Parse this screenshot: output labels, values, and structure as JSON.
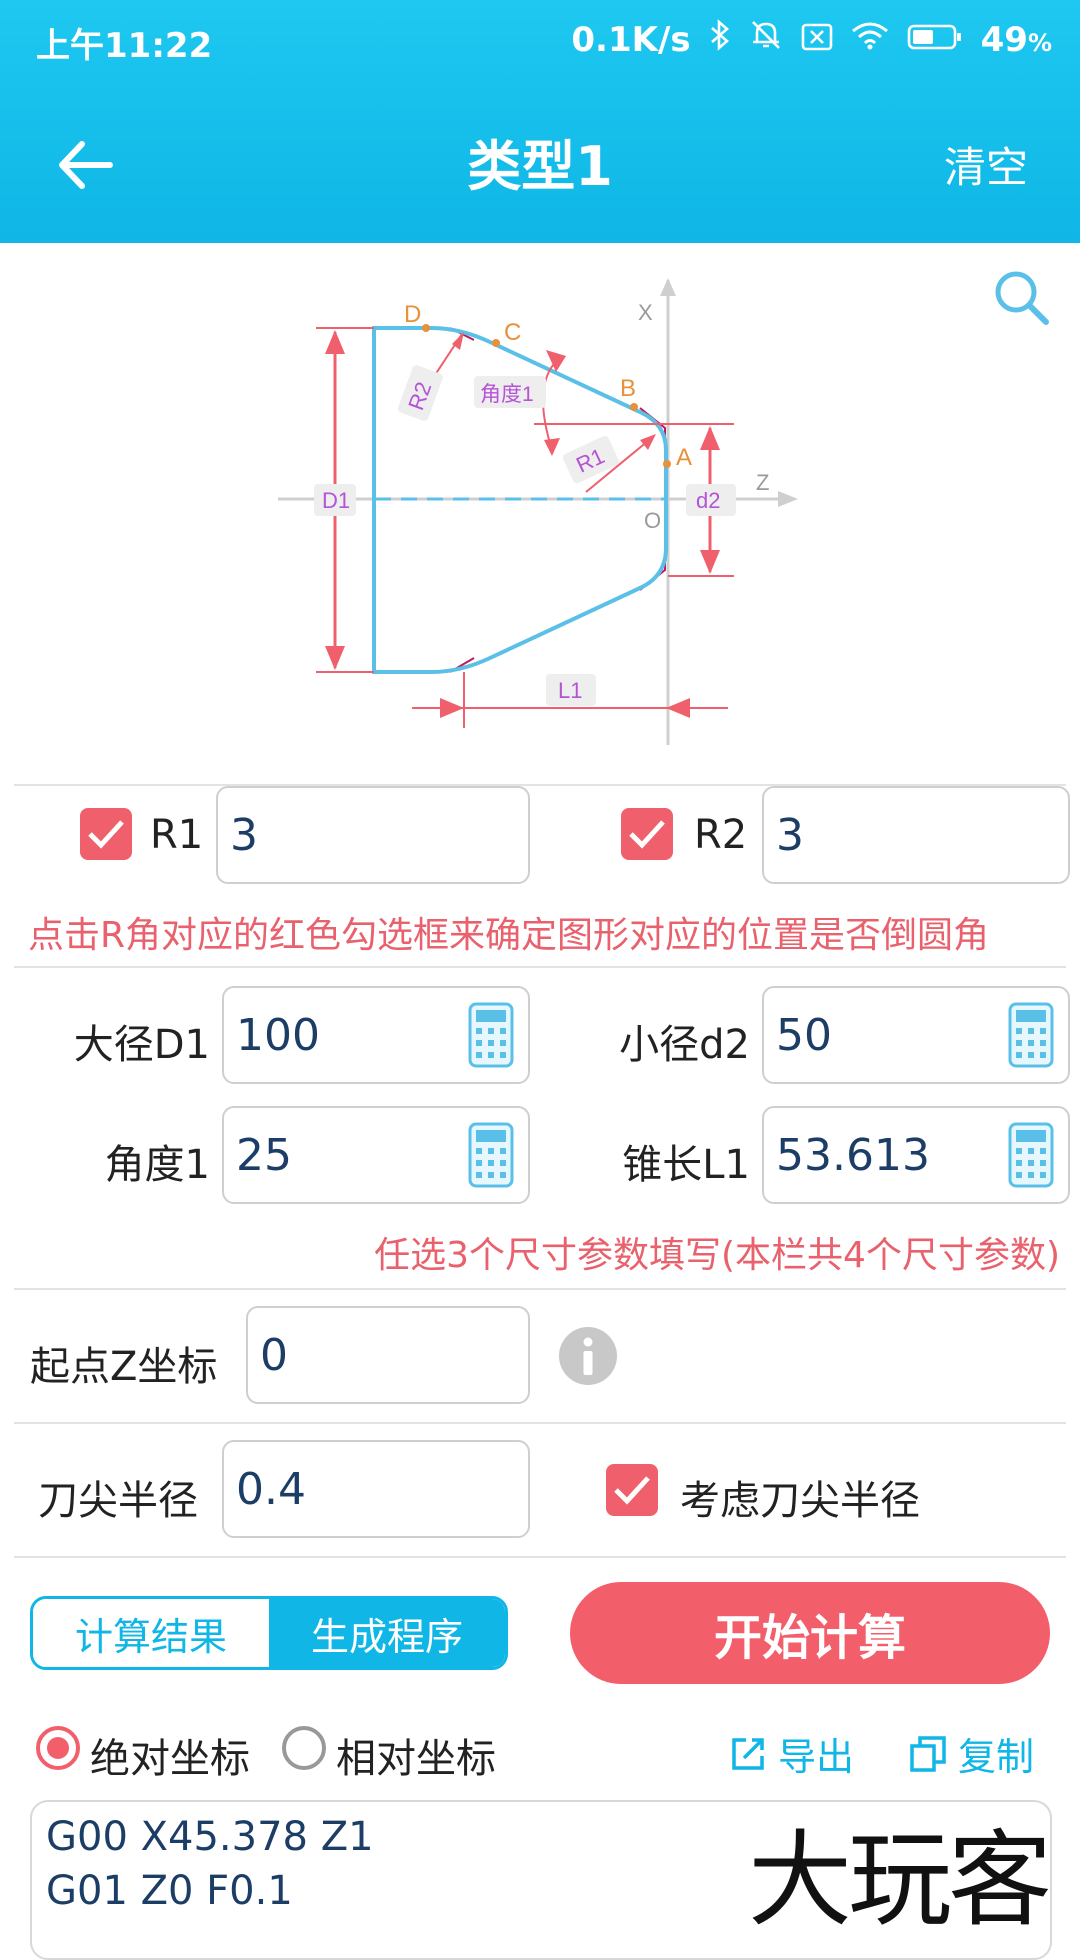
{
  "status_bar": {
    "time": "上午11:22",
    "net_speed": "0.1K/s",
    "battery": "49"
  },
  "header": {
    "title": "类型1",
    "clear_label": "清空"
  },
  "diagram": {
    "labels": {
      "x_axis": "X",
      "z_axis": "Z",
      "origin": "O",
      "point_a": "A",
      "point_b": "B",
      "point_c": "C",
      "point_d": "D",
      "r1": "R1",
      "r2": "R2",
      "angle1": "角度1",
      "d1": "D1",
      "d2": "d2",
      "l1": "L1"
    }
  },
  "fillet": {
    "r1_label": "R1",
    "r1_value": "3",
    "r1_checked": true,
    "r2_label": "R2",
    "r2_value": "3",
    "r2_checked": true,
    "note": "点击R角对应的红色勾选框来确定图形对应的位置是否倒圆角"
  },
  "dimensions": {
    "d1_label": "大径D1",
    "d1_value": "100",
    "d2_label": "小径d2",
    "d2_value": "50",
    "angle_label": "角度1",
    "angle_value": "25",
    "l1_label": "锥长L1",
    "l1_value": "53.613",
    "note": "任选3个尺寸参数填写(本栏共4个尺寸参数)"
  },
  "start_z": {
    "label": "起点Z坐标",
    "value": "0"
  },
  "tool": {
    "label": "刀尖半径",
    "value": "0.4",
    "consider_label": "考虑刀尖半径",
    "consider_checked": true
  },
  "actions": {
    "tab_result": "计算结果",
    "tab_program": "生成程序",
    "start_label": "开始计算"
  },
  "output": {
    "abs_label": "绝对坐标",
    "rel_label": "相对坐标",
    "export_label": "导出",
    "copy_label": "复制",
    "code_lines": [
      "G00 X45.378 Z1",
      "G01 Z0 F0.1"
    ]
  },
  "watermark": "大玩客",
  "colors": {
    "primary": "#0fb6e6",
    "accent": "#f35e6b",
    "profile": "#5bc0e8",
    "dimension": "#f05f6c",
    "point": "#e8903a",
    "label_text": "#b553d6"
  }
}
